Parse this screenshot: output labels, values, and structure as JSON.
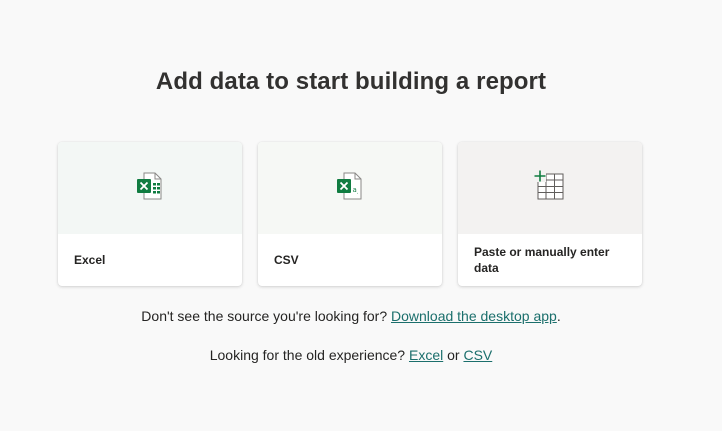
{
  "header": {
    "title": "Add data to start building a report"
  },
  "cards": [
    {
      "id": "excel",
      "label": "Excel",
      "icon": "excel-file-icon"
    },
    {
      "id": "csv",
      "label": "CSV",
      "icon": "csv-file-icon"
    },
    {
      "id": "paste",
      "label": "Paste or manually enter data",
      "icon": "table-add-icon"
    }
  ],
  "footer": {
    "source_prompt": "Don't see the source you're looking for?",
    "download_link": "Download the desktop app",
    "period": ".",
    "old_prompt": "Looking for the old experience?",
    "old_excel_link": "Excel",
    "or": "or",
    "old_csv_link": "CSV"
  },
  "colors": {
    "excel_green": "#107c41",
    "link_teal": "#1b6f6c"
  }
}
